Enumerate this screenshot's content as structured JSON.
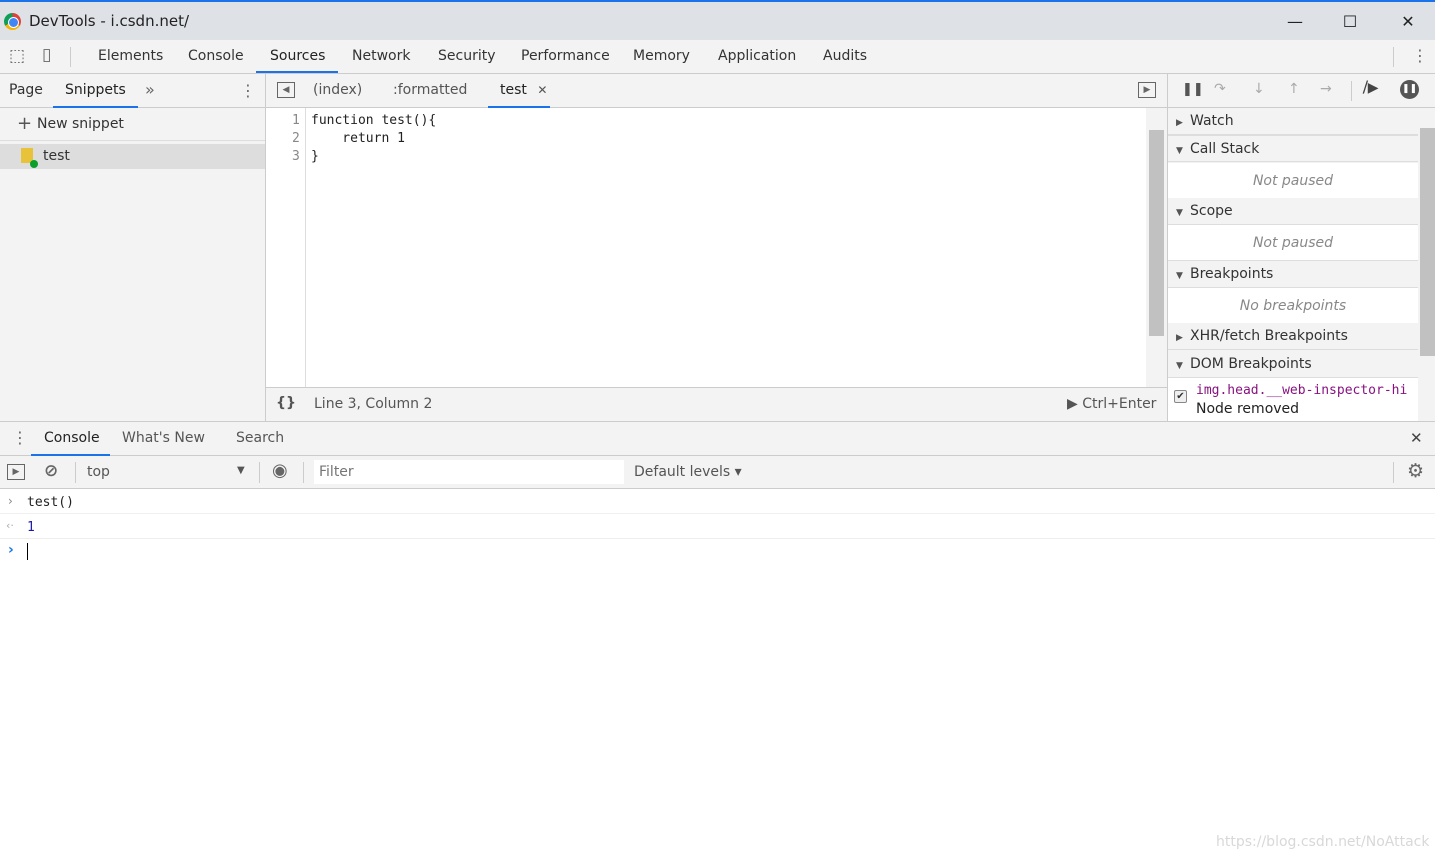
{
  "window": {
    "title": "DevTools - i.csdn.net/",
    "minimize": "—",
    "maximize": "☐",
    "close": "✕"
  },
  "main_tabs": [
    {
      "label": "Elements"
    },
    {
      "label": "Console"
    },
    {
      "label": "Sources",
      "selected": true
    },
    {
      "label": "Network"
    },
    {
      "label": "Security"
    },
    {
      "label": "Performance"
    },
    {
      "label": "Memory"
    },
    {
      "label": "Application"
    },
    {
      "label": "Audits"
    }
  ],
  "navigator": {
    "tabs": [
      {
        "label": "Page"
      },
      {
        "label": "Snippets",
        "selected": true
      }
    ],
    "more": "»",
    "new_snippet": "New snippet",
    "items": [
      {
        "label": "test"
      }
    ]
  },
  "editor": {
    "tabs": [
      {
        "label": "(index)"
      },
      {
        "label": ":formatted"
      },
      {
        "label": "test",
        "selected": true
      }
    ],
    "lines": [
      {
        "num": "1",
        "code": "function test(){"
      },
      {
        "num": "2",
        "code": "    return 1"
      },
      {
        "num": "3",
        "code": "}"
      }
    ],
    "status": {
      "format": "{}",
      "position": "Line 3, Column 2",
      "run": "▶ Ctrl+Enter"
    }
  },
  "sidebar": {
    "sections": [
      {
        "title": "Watch",
        "expanded": false
      },
      {
        "title": "Call Stack",
        "expanded": true,
        "body": "Not paused"
      },
      {
        "title": "Scope",
        "expanded": true,
        "body": "Not paused"
      },
      {
        "title": "Breakpoints",
        "expanded": true,
        "body": "No breakpoints"
      },
      {
        "title": "XHR/fetch Breakpoints",
        "expanded": false
      },
      {
        "title": "DOM Breakpoints",
        "expanded": true
      }
    ],
    "dom_breakpoint": {
      "selector": "img.head.__web-inspector-hi",
      "type": "Node removed",
      "checked": true
    }
  },
  "drawer": {
    "tabs": [
      {
        "label": "Console",
        "selected": true
      },
      {
        "label": "What's New"
      },
      {
        "label": "Search"
      }
    ]
  },
  "console": {
    "context": "top",
    "filter_placeholder": "Filter",
    "levels": "Default levels ▾",
    "entries": [
      {
        "prompt": "›",
        "text": "test()"
      },
      {
        "prompt": "‹·",
        "text": "1"
      }
    ],
    "input_prompt": "›"
  },
  "watermark": "https://blog.csdn.net/NoAttack",
  "colors": {
    "accent": "#1a73e8",
    "result": "#1a1aa6",
    "selector": "#881280"
  }
}
